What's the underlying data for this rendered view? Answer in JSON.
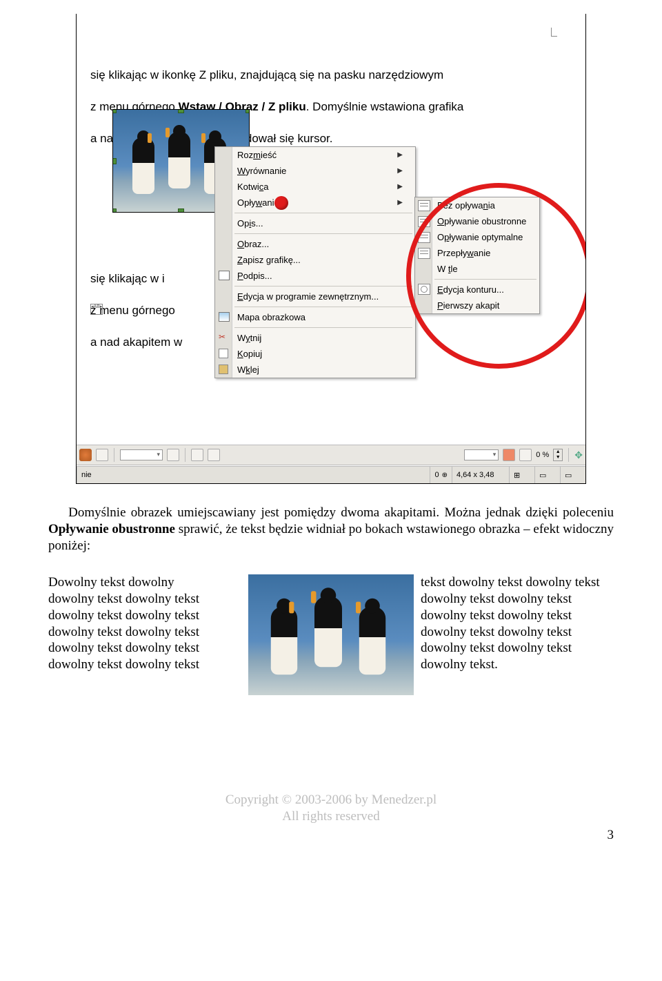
{
  "screenshot": {
    "doc_line1": "  się klikając w ikonkę Z pliku, znajdującą się na pasku narzędziowym",
    "doc_line2": "z menu górnego Wstaw / Obraz / Z pliku. Domyślnie wstawiona grafika",
    "doc_line3": "a nad akapitem w którym znajdował się kursor.",
    "doc2_line1": "  się klikając w i",
    "doc2_line2": "z menu górnego",
    "doc2_line3": "a nad akapitem w",
    "ctx": {
      "rozmiesc": "Rozmieść",
      "wyrownanie": "Wyrównanie",
      "kotwica": "Kotwica",
      "oplywanie": "Opływanie",
      "opis": "Opis...",
      "obraz": "Obraz...",
      "zapisz": "Zapisz grafikę...",
      "podpis": "Podpis...",
      "edycja_ext": "Edycja w programie zewnętrznym...",
      "mapa": "Mapa obrazkowa",
      "wytnij": "Wytnij",
      "kopiuj": "Kopiuj",
      "wklej": "Wklej"
    },
    "sub": {
      "bez": "Bez opływania",
      "obustronne": "Opływanie obustronne",
      "optymalne": "Opływanie optymalne",
      "przeplyw": "Przepływanie",
      "wtle": "W tle",
      "kontur": "Edycja konturu...",
      "pierwszy": "Pierwszy akapit"
    },
    "toolbar": {
      "zoom": "0 %"
    },
    "status": {
      "nie": "nie",
      "zero": "0",
      "size": "4,64 x 3,48"
    }
  },
  "para1_pre": "Domyślnie obrazek umiejscawiany jest pomiędzy dwoma akapitami. Można jednak dzięki poleceniu ",
  "para1_bold": "Opływanie obustronne",
  "para1_post": " sprawić, że tekst będzie widniał po bokach wstawionego obrazka – efekt widoczny  poniżej:",
  "wrap": {
    "left": "Dowolny tekst dowolny\ndowolny tekst dowolny tekst\ndowolny tekst dowolny tekst\ndowolny tekst dowolny tekst\ndowolny tekst dowolny tekst\ndowolny tekst dowolny tekst",
    "right": "tekst dowolny tekst dowolny tekst\ndowolny   tekst   dowolny   tekst\ndowolny   tekst   dowolny   tekst\ndowolny   tekst   dowolny   tekst\ndowolny   tekst   dowolny   tekst\ndowolny tekst."
  },
  "footer": {
    "line1": "Copyright © 2003-2006 by Menedzer.pl",
    "line2": "All rights reserved"
  },
  "pagenum": "3"
}
